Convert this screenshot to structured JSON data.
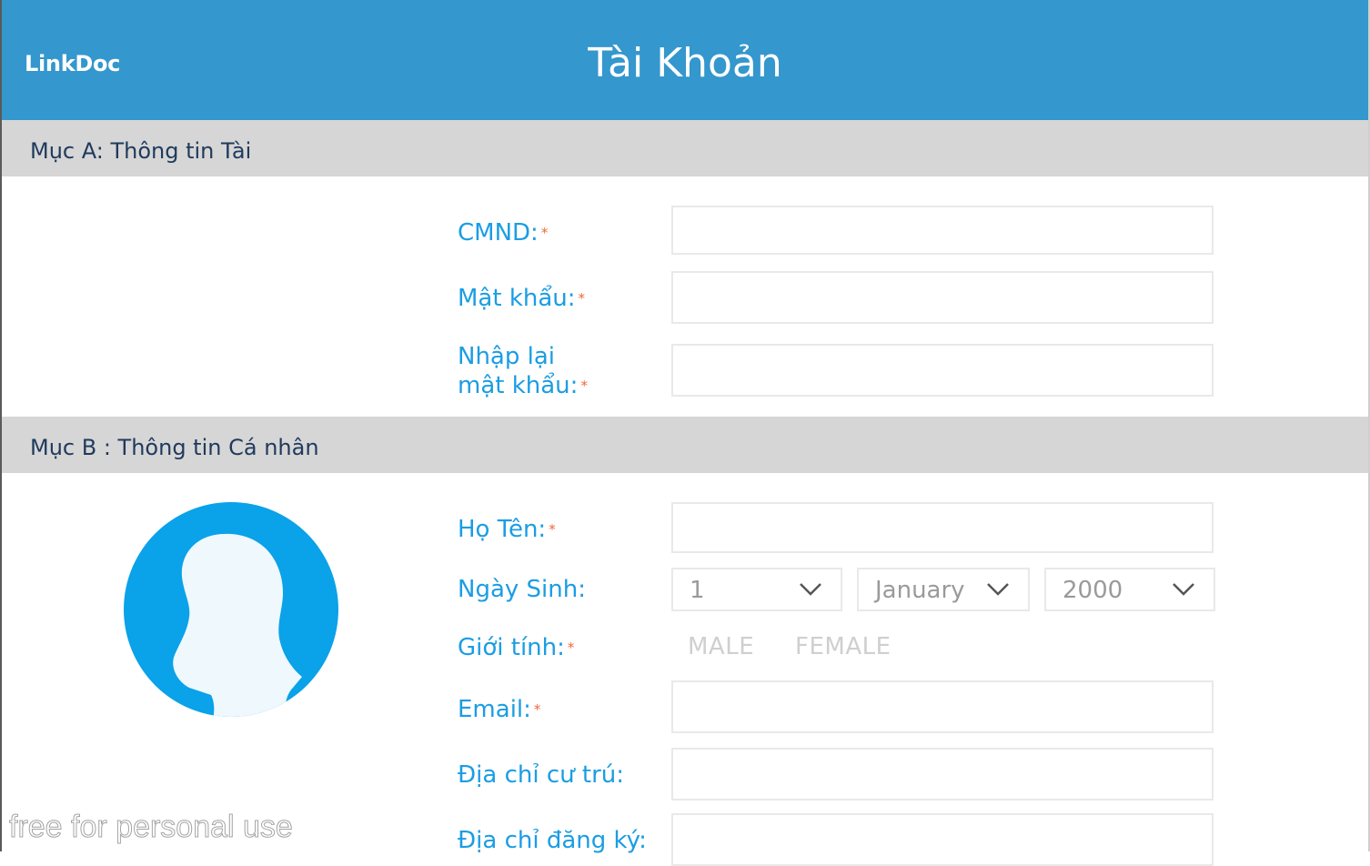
{
  "header": {
    "logo": "LinkDoc",
    "title": "Tài Khoản",
    "color": "#3497cd"
  },
  "section_a": {
    "title": "Mục A: Thông tin Tài",
    "cmnd_label": "CMND:",
    "password_label": "Mật khẩu:",
    "confirm_label_line1": "Nhập lại",
    "confirm_label_line2": "mật khẩu:"
  },
  "section_b": {
    "title": "Mục B : Thông tin Cá nhân",
    "name_label": "Họ Tên:",
    "dob_label": "Ngày Sinh:",
    "dob_day": "1",
    "dob_month": "January",
    "dob_year": "2000",
    "gender_label": "Giới tính:",
    "gender_male": "MALE",
    "gender_female": "FEMALE",
    "email_label": "Email:",
    "residence_label": "Địa chỉ cư trú:",
    "registered_label": "Địa chỉ đăng ký:"
  },
  "required_mark": "*",
  "icons": {
    "avatar": "user-silhouette-icon",
    "dropdown": "chevron-down-icon"
  },
  "watermark": "free for personal use",
  "colors": {
    "label": "#1b9de3",
    "required": "#f0673b",
    "section_bg": "#d6d6d6",
    "avatar": "#0aa2e8"
  }
}
